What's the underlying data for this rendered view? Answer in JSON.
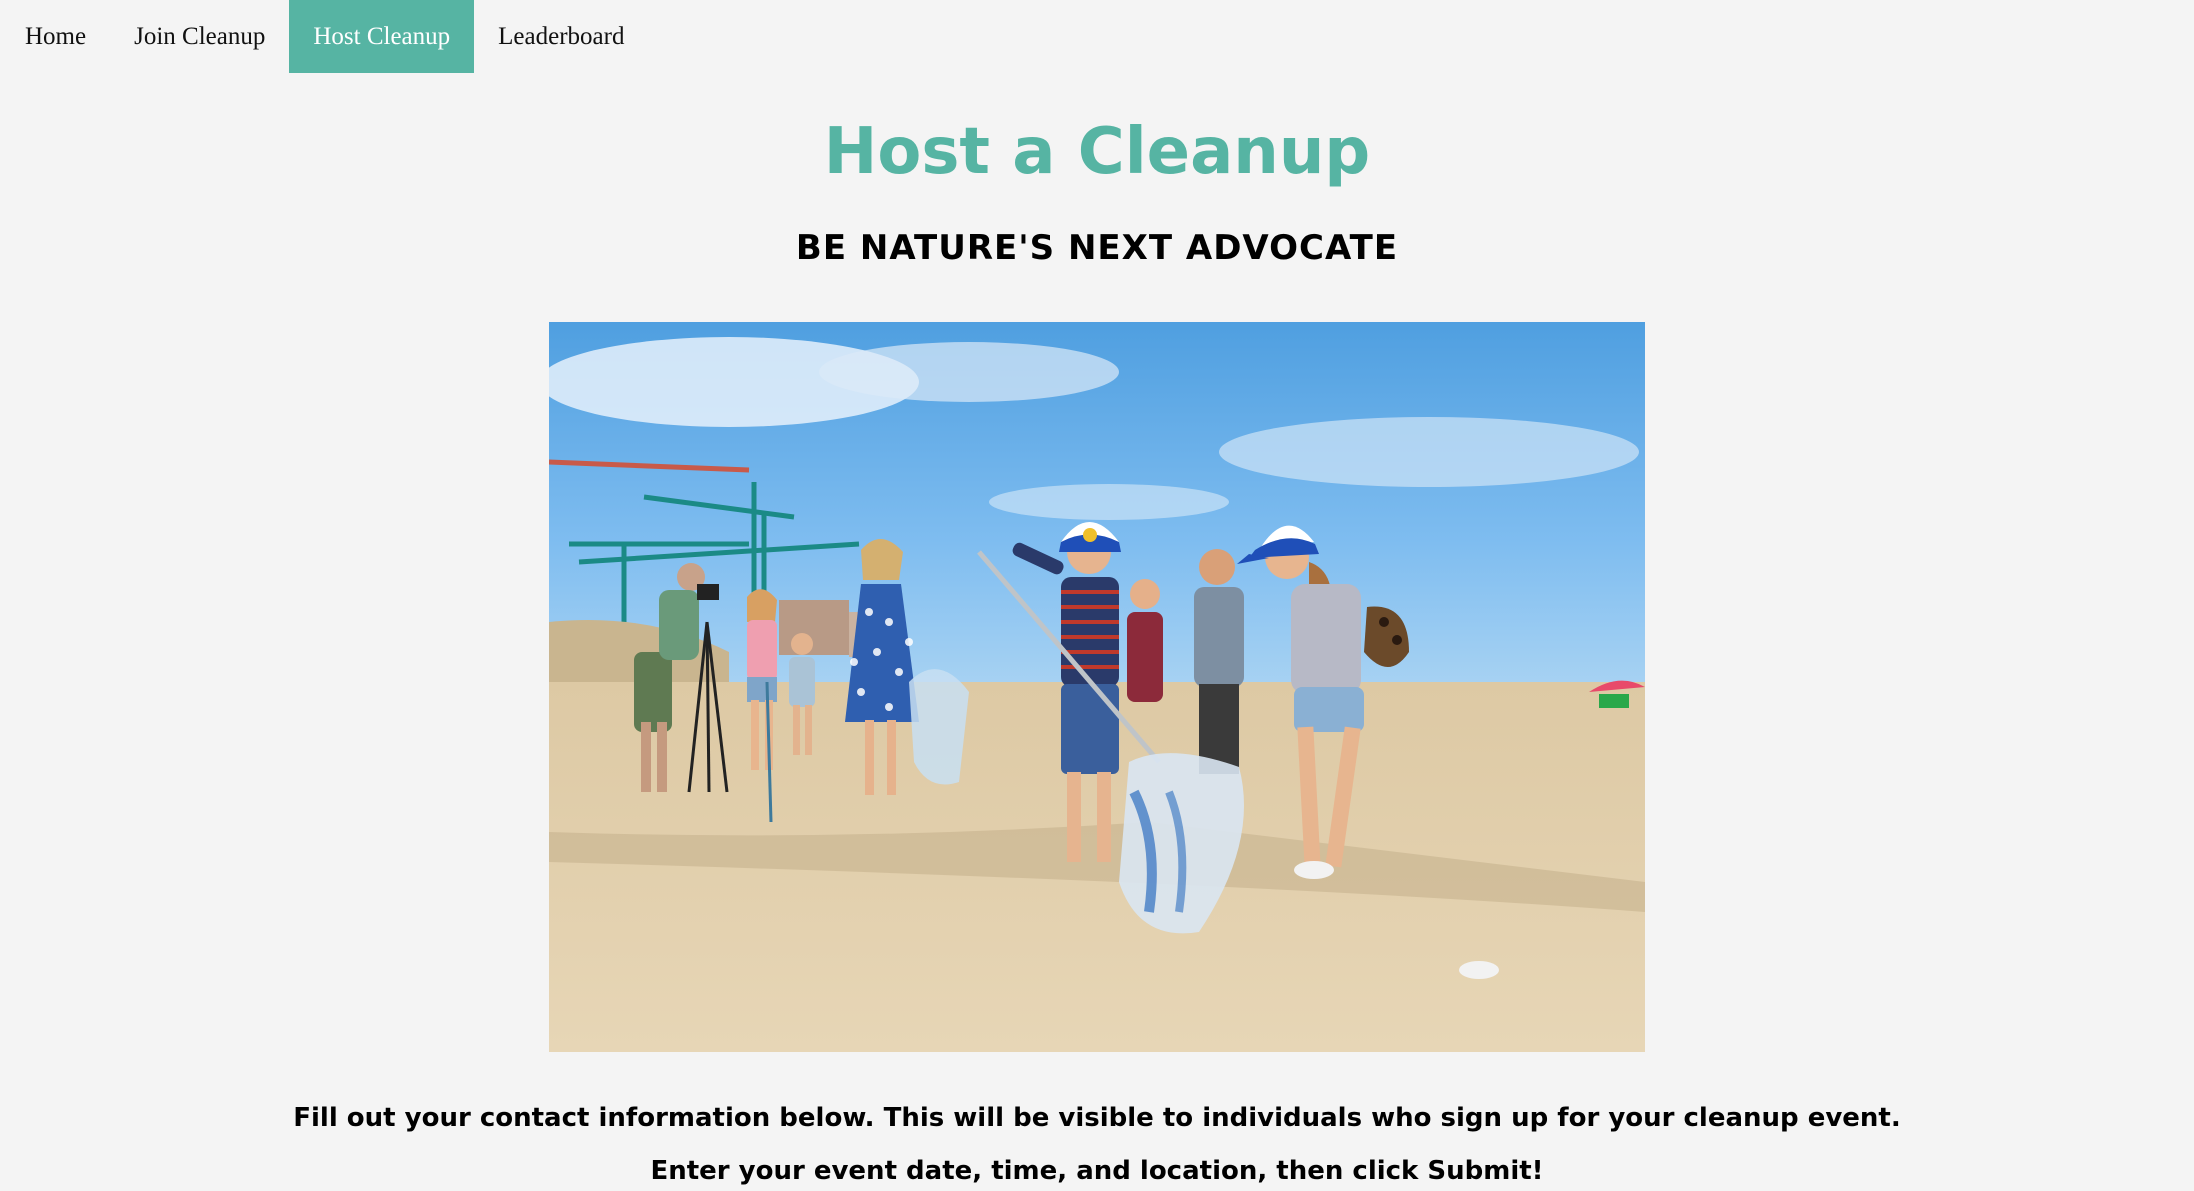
{
  "nav": {
    "items": [
      {
        "label": "Home",
        "active": false
      },
      {
        "label": "Join Cleanup",
        "active": false
      },
      {
        "label": "Host Cleanup",
        "active": true
      },
      {
        "label": "Leaderboard",
        "active": false
      }
    ]
  },
  "header": {
    "title": "Host a Cleanup",
    "subtitle": "BE NATURE'S NEXT ADVOCATE"
  },
  "colors": {
    "accent": "#56b4a3",
    "background": "#f4f4f4",
    "text": "#000000"
  },
  "instructions": {
    "line1": "Fill out your contact information below. This will be visible to individuals who sign up for your cleanup event.",
    "line2": "Enter your event date, time, and location, then click Submit!"
  }
}
